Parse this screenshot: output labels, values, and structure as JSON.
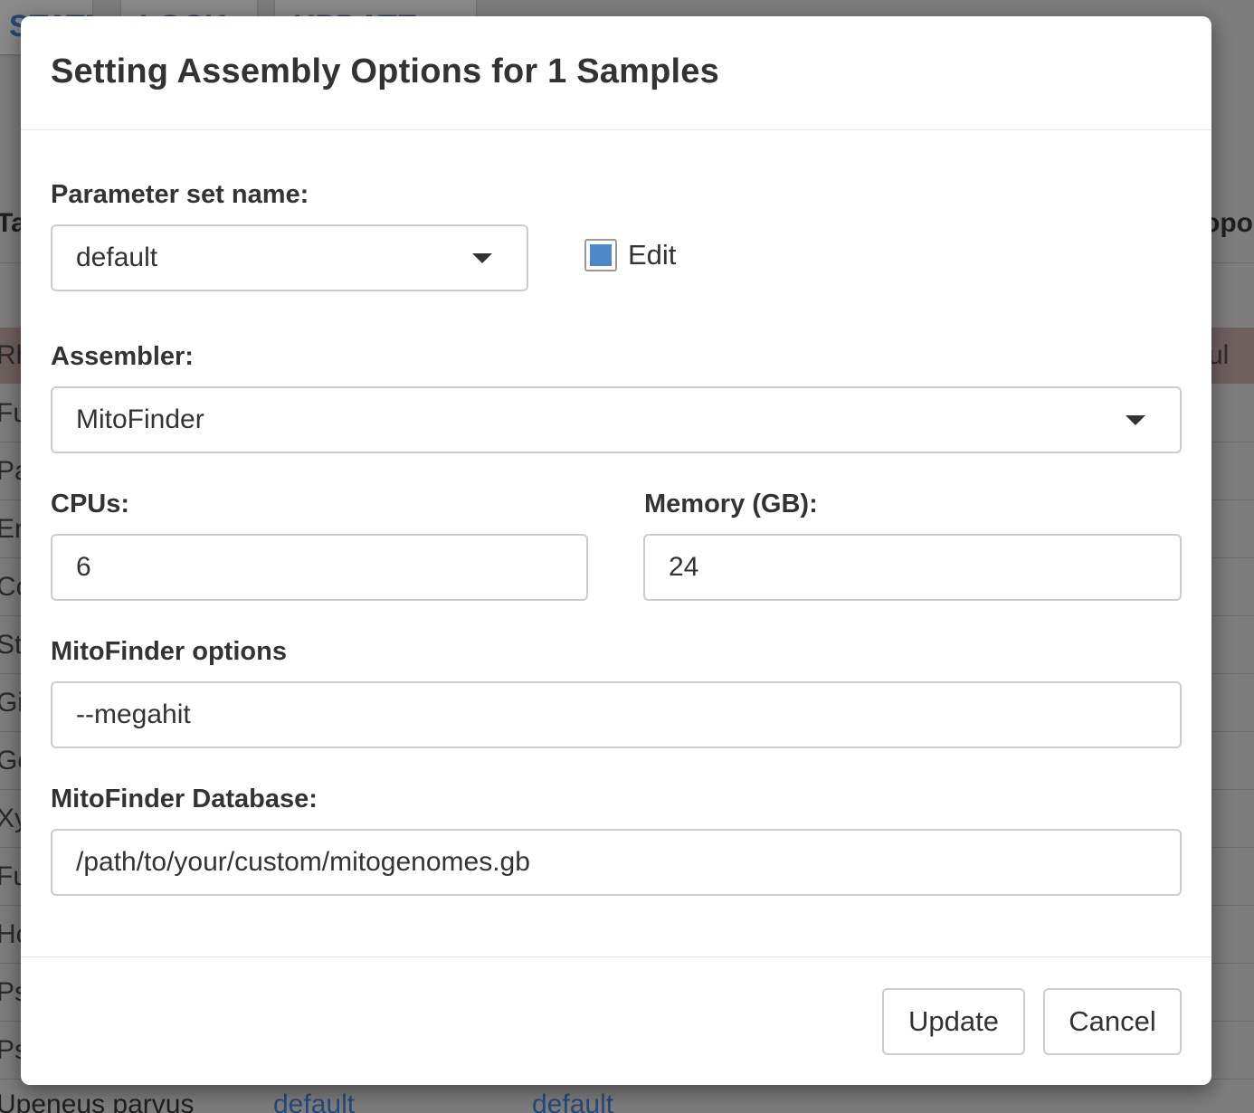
{
  "background": {
    "toolbar_buttons": [
      "STATE",
      "LOCK",
      "UPDATE"
    ],
    "column_header_left": "Ta",
    "column_header_right": "opo",
    "row_prefixes": [
      "Rh",
      "Fu",
      "Pa",
      "Er",
      "Co",
      "St",
      "Gi",
      "Ge",
      "Xy",
      "Fu",
      "Ho",
      "Ps",
      "Ps"
    ],
    "highlight_row_right_text": "rcul",
    "bottom_row": {
      "species": "Upeneus parvus",
      "col2": "default",
      "col3": "default"
    }
  },
  "modal": {
    "title": "Setting Assembly Options for 1 Samples",
    "parameter_set": {
      "label": "Parameter set name:",
      "value": "default"
    },
    "edit_checkbox": {
      "label": "Edit",
      "checked": true
    },
    "assembler": {
      "label": "Assembler:",
      "value": "MitoFinder"
    },
    "cpus": {
      "label": "CPUs:",
      "value": "6"
    },
    "memory": {
      "label": "Memory (GB):",
      "value": "24"
    },
    "options": {
      "label": "MitoFinder options",
      "value": "--megahit"
    },
    "database": {
      "label": "MitoFinder Database:",
      "value": "/path/to/your/custom/mitogenomes.gb"
    },
    "footer": {
      "update_label": "Update",
      "cancel_label": "Cancel"
    }
  },
  "colors": {
    "checkbox_accent": "#4f88c9",
    "overlay": "#7d7d7d",
    "link_blue": "#27497a"
  }
}
